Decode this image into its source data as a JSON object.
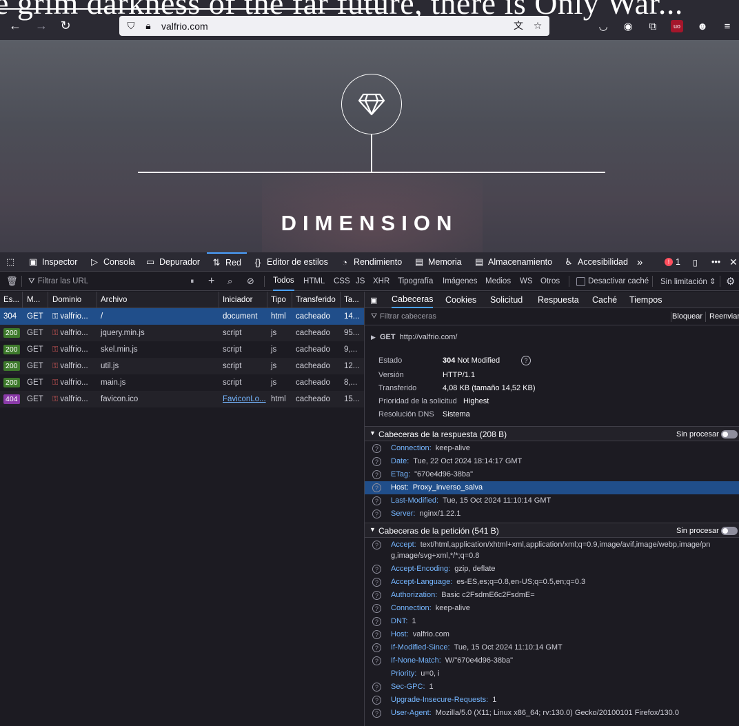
{
  "browser": {
    "banner_text": "e grim darkness of the far future, there is Only War...",
    "url": "valfrio.com",
    "icons": [
      "back-icon",
      "forward-icon",
      "reload-icon",
      "shield-icon",
      "lock-icon",
      "translate-icon",
      "star-icon",
      "pocket-icon",
      "account-icon",
      "extensions-icon",
      "ublock-icon",
      "fox-extension-icon",
      "menu-icon"
    ]
  },
  "hero": {
    "title": "DIMENSION",
    "logo_icon": "diamond-icon"
  },
  "devtools": {
    "tabs": [
      {
        "label": "Inspector",
        "icon": "inspector-icon"
      },
      {
        "label": "Consola",
        "icon": "console-icon"
      },
      {
        "label": "Depurador",
        "icon": "debugger-icon"
      },
      {
        "label": "Red",
        "icon": "network-icon"
      },
      {
        "label": "Editor de estilos",
        "icon": "style-editor-icon"
      },
      {
        "label": "Rendimiento",
        "icon": "performance-icon"
      },
      {
        "label": "Memoria",
        "icon": "memory-icon"
      },
      {
        "label": "Almacenamiento",
        "icon": "storage-icon"
      },
      {
        "label": "Accesibilidad",
        "icon": "accessibility-icon"
      }
    ],
    "error_count": "1",
    "network_toolbar": {
      "filter_placeholder": "Filtrar las URL",
      "filters": [
        "Todos",
        "HTML",
        "CSS",
        "JS",
        "XHR",
        "Tipografía",
        "Imágenes",
        "Medios",
        "WS",
        "Otros"
      ],
      "disable_cache": "Desactivar caché",
      "throttle": "Sin limitación ⇕"
    },
    "requests": {
      "columns": [
        "Es...",
        "M...",
        "Dominio",
        "Archivo",
        "Iniciador",
        "Tipo",
        "Transferido",
        "Ta..."
      ],
      "rows": [
        {
          "status": "304",
          "method": "GET",
          "domain": "valfrio...",
          "file": "/",
          "initiator": "document",
          "type": "html",
          "transferred": "cacheado",
          "size": "14..."
        },
        {
          "status": "200",
          "method": "GET",
          "domain": "valfrio...",
          "file": "jquery.min.js",
          "initiator": "script",
          "type": "js",
          "transferred": "cacheado",
          "size": "95..."
        },
        {
          "status": "200",
          "method": "GET",
          "domain": "valfrio...",
          "file": "skel.min.js",
          "initiator": "script",
          "type": "js",
          "transferred": "cacheado",
          "size": "9,..."
        },
        {
          "status": "200",
          "method": "GET",
          "domain": "valfrio...",
          "file": "util.js",
          "initiator": "script",
          "type": "js",
          "transferred": "cacheado",
          "size": "12..."
        },
        {
          "status": "200",
          "method": "GET",
          "domain": "valfrio...",
          "file": "main.js",
          "initiator": "script",
          "type": "js",
          "transferred": "cacheado",
          "size": "8,..."
        },
        {
          "status": "404",
          "method": "GET",
          "domain": "valfrio...",
          "file": "favicon.ico",
          "initiator": "FaviconLo...",
          "type": "html",
          "transferred": "cacheado",
          "size": "15..."
        }
      ]
    },
    "details": {
      "tabs": [
        "Cabeceras",
        "Cookies",
        "Solicitud",
        "Respuesta",
        "Caché",
        "Tiempos"
      ],
      "filter_placeholder": "Filtrar cabeceras",
      "block": "Bloquear",
      "resend": "Reenviar",
      "request_line": "GET",
      "request_url": "http://valfrio.com/",
      "summary": [
        {
          "k": "Estado",
          "v": "304 Not Modified"
        },
        {
          "k": "Versión",
          "v": "HTTP/1.1"
        },
        {
          "k": "Transferido",
          "v": "4,08 KB (tamaño 14,52 KB)"
        },
        {
          "k": "Prioridad de la solicitud",
          "v": "Highest"
        },
        {
          "k": "Resolución DNS",
          "v": "Sistema"
        }
      ],
      "raw_label": "Sin procesar",
      "response_title": "Cabeceras de la respuesta (208 B)",
      "response_headers": [
        {
          "k": "Connection:",
          "v": "keep-alive"
        },
        {
          "k": "Date:",
          "v": "Tue, 22 Oct 2024 18:14:17 GMT"
        },
        {
          "k": "ETag:",
          "v": "\"670e4d96-38ba\""
        },
        {
          "k": "Host:",
          "v": "Proxy_inverso_salva"
        },
        {
          "k": "Last-Modified:",
          "v": "Tue, 15 Oct 2024 11:10:14 GMT"
        },
        {
          "k": "Server:",
          "v": "nginx/1.22.1"
        }
      ],
      "request_title": "Cabeceras de la petición (541 B)",
      "request_headers": [
        {
          "k": "Accept:",
          "v": "text/html,application/xhtml+xml,application/xml;q=0.9,image/avif,image/webp,image/pn",
          "v2": "g,image/svg+xml,*/*;q=0.8"
        },
        {
          "k": "Accept-Encoding:",
          "v": "gzip, deflate"
        },
        {
          "k": "Accept-Language:",
          "v": "es-ES,es;q=0.8,en-US;q=0.5,en;q=0.3"
        },
        {
          "k": "Authorization:",
          "v": "Basic c2FsdmE6c2FsdmE="
        },
        {
          "k": "Connection:",
          "v": "keep-alive"
        },
        {
          "k": "DNT:",
          "v": "1"
        },
        {
          "k": "Host:",
          "v": "valfrio.com"
        },
        {
          "k": "If-Modified-Since:",
          "v": "Tue, 15 Oct 2024 11:10:14 GMT"
        },
        {
          "k": "If-None-Match:",
          "v": "W/\"670e4d96-38ba\""
        },
        {
          "k": "Priority:",
          "v": "u=0, i"
        },
        {
          "k": "Sec-GPC:",
          "v": "1"
        },
        {
          "k": "Upgrade-Insecure-Requests:",
          "v": "1"
        },
        {
          "k": "User-Agent:",
          "v": "Mozilla/5.0 (X11; Linux x86_64; rv:130.0) Gecko/20100101 Firefox/130.0"
        }
      ]
    }
  }
}
